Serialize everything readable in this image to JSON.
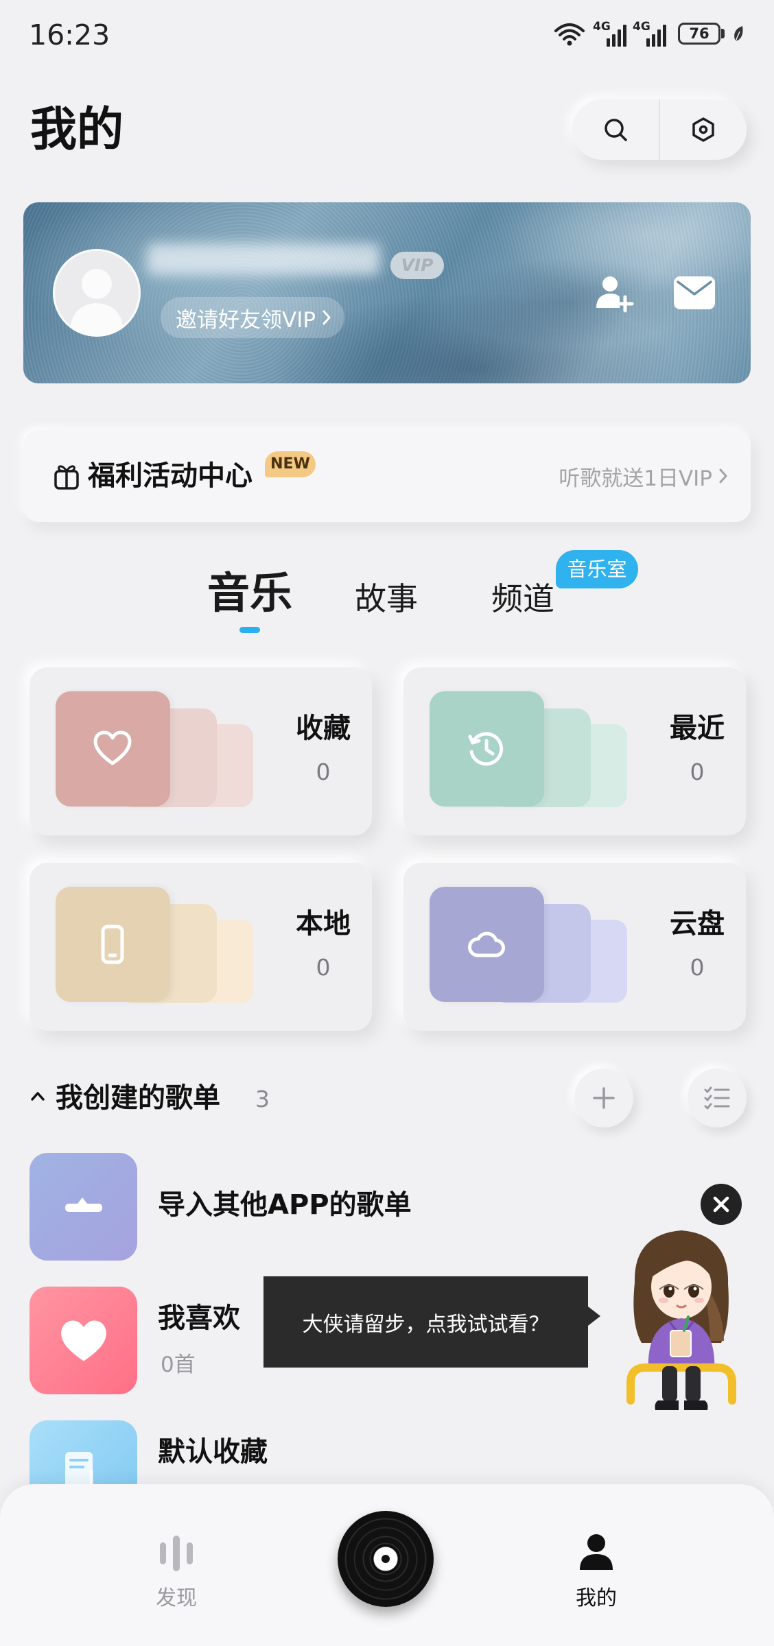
{
  "status_bar": {
    "time": "16:23",
    "network_1": "4G",
    "network_2": "4G",
    "battery": "76"
  },
  "header": {
    "title": "我的",
    "search_icon": "search-icon",
    "settings_icon": "settings-hexagon-icon"
  },
  "profile": {
    "avatar_icon": "default-avatar-icon",
    "vip_badge": "VIP",
    "invite_label": "邀请好友领VIP",
    "add_friend_icon": "add-friend-icon",
    "message_icon": "mail-icon"
  },
  "welfare": {
    "icon": "gift-icon",
    "title": "福利活动中心",
    "badge": "NEW",
    "promo": "听歌就送1日VIP"
  },
  "tabs": {
    "items": [
      {
        "label": "音乐",
        "active": true
      },
      {
        "label": "故事",
        "active": false
      },
      {
        "label": "频道",
        "active": false
      }
    ],
    "badge": "音乐室"
  },
  "library": [
    {
      "label": "收藏",
      "count": "0",
      "icon": "heart-icon",
      "colors": {
        "front": "#d8a9a5",
        "middle": "#ead2cf",
        "back": "#efdcd9"
      }
    },
    {
      "label": "最近",
      "count": "0",
      "icon": "history-clock-icon",
      "colors": {
        "front": "#a8d3c6",
        "middle": "#c5e2d9",
        "back": "#d6ece5"
      }
    },
    {
      "label": "本地",
      "count": "0",
      "icon": "phone-icon",
      "colors": {
        "front": "#e5d2b2",
        "middle": "#efe0c6",
        "back": "#f8ead4"
      }
    },
    {
      "label": "云盘",
      "count": "0",
      "icon": "cloud-icon",
      "colors": {
        "front": "#a6a8d3",
        "middle": "#c4c6ea",
        "back": "#d6d8f4"
      }
    }
  ],
  "created_playlists": {
    "title": "我创建的歌单",
    "count": "3",
    "items": [
      {
        "title": "导入其他APP的歌单",
        "icon": "import-icon",
        "cover_color": "linear-gradient(135deg,#9fb3e3,#a6a2df)"
      },
      {
        "title": "我喜欢",
        "subtitle": "0首",
        "icon": "heart-filled-icon",
        "cover_color": "linear-gradient(135deg,#ff95a2,#ff6f86)"
      },
      {
        "title": "默认收藏",
        "icon": "music-doc-icon",
        "cover_color": "linear-gradient(135deg,#a9def9,#7ec8f2)"
      }
    ]
  },
  "mascot": {
    "tooltip": "大侠请留步，点我试试看？"
  },
  "bottom_nav": {
    "items": [
      {
        "label": "发现",
        "icon": "discover-bars-icon",
        "active": false
      },
      {
        "label": "我的",
        "icon": "person-icon",
        "active": true
      }
    ],
    "center_icon": "vinyl-disc-icon"
  },
  "colors": {
    "background": "#f1f1f3",
    "accent": "#2ab0ef",
    "new_badge": "#f3c983",
    "tooltip_bg": "#2b2b2b"
  }
}
